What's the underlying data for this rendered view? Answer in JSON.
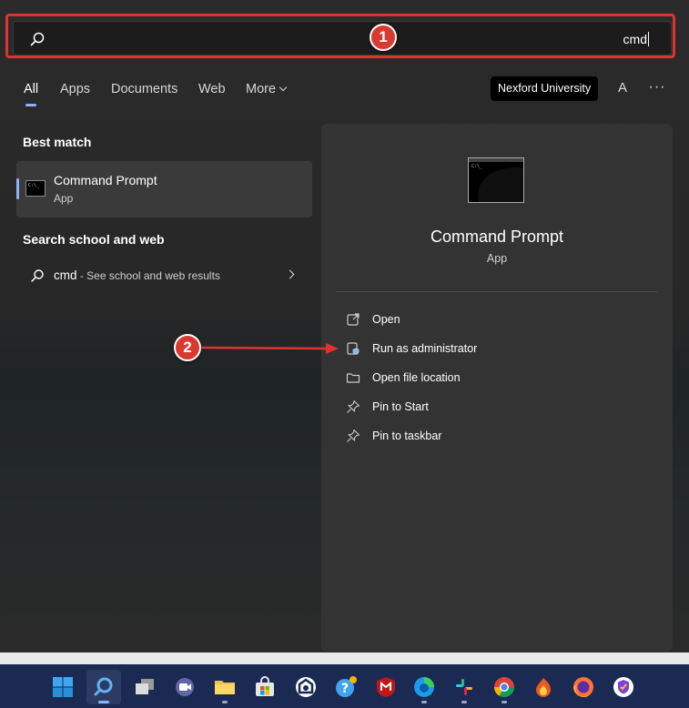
{
  "search": {
    "value": "cmd"
  },
  "callouts": {
    "one": "1",
    "two": "2"
  },
  "tabs": [
    {
      "label": "All"
    },
    {
      "label": "Apps"
    },
    {
      "label": "Documents"
    },
    {
      "label": "Web"
    },
    {
      "label": "More"
    }
  ],
  "header": {
    "org": "Nexford University",
    "avatar": "A",
    "more": "···"
  },
  "best_match": {
    "section": "Best match",
    "title": "Command Prompt",
    "subtitle": "App"
  },
  "school_web": {
    "section": "Search school and web",
    "query": "cmd",
    "suffix": " - See school and web results"
  },
  "details": {
    "title": "Command Prompt",
    "subtitle": "App",
    "actions": [
      {
        "label": "Open",
        "icon": "open-icon"
      },
      {
        "label": "Run as administrator",
        "icon": "shield-icon"
      },
      {
        "label": "Open file location",
        "icon": "folder-icon"
      },
      {
        "label": "Pin to Start",
        "icon": "pin-icon"
      },
      {
        "label": "Pin to taskbar",
        "icon": "pin-icon"
      }
    ]
  },
  "colors": {
    "callout": "#d83a32",
    "highlight": "#e0322f",
    "accent": "#8ab4f8",
    "taskbar": "#1a2a52"
  },
  "taskbar_icons": [
    "windows-start-icon",
    "search-icon",
    "task-view-icon",
    "teams-chat-icon",
    "file-explorer-icon",
    "store-icon",
    "browser-icon",
    "help-icon",
    "mcafee-icon",
    "edge-icon",
    "slack-icon",
    "chrome-icon",
    "app-icon",
    "firefox-icon",
    "vpn-icon"
  ]
}
